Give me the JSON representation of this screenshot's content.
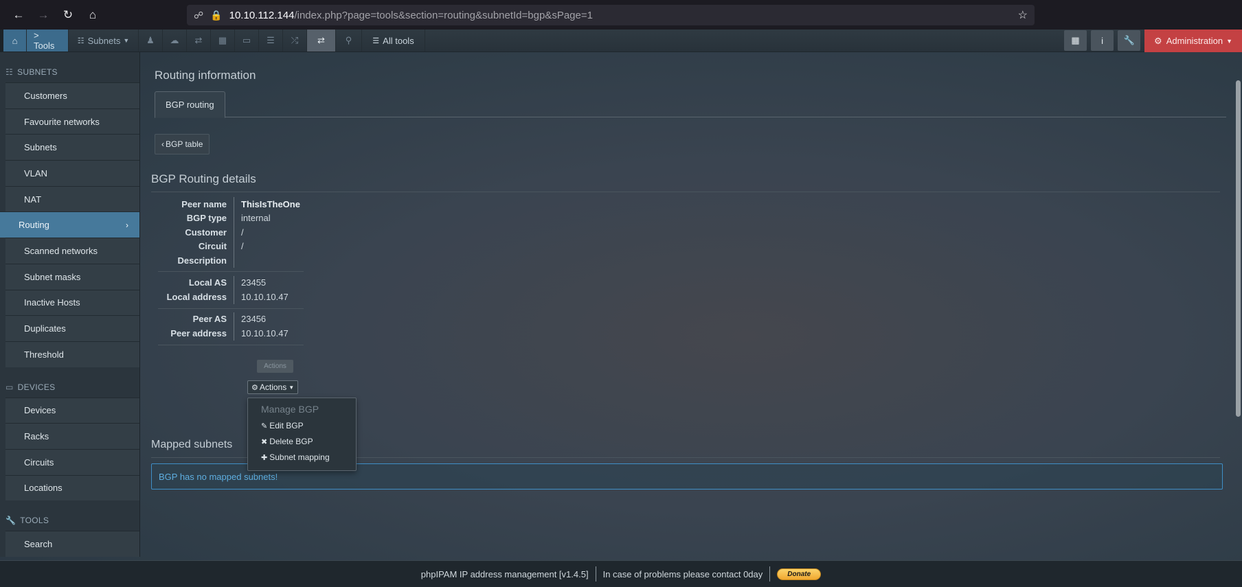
{
  "browser": {
    "url_host": "10.10.112.144",
    "url_path": "/index.php?page=tools&section=routing&subnetId=bgp&sPage=1"
  },
  "topnav": {
    "tools_label": "> Tools",
    "subnets_label": "Subnets",
    "all_tools_label": "All tools",
    "admin_label": "Administration"
  },
  "sidebar": {
    "subnets_heading": "SUBNETS",
    "subnets_items": [
      {
        "label": "Customers"
      },
      {
        "label": "Favourite networks"
      },
      {
        "label": "Subnets"
      },
      {
        "label": "VLAN"
      },
      {
        "label": "NAT"
      },
      {
        "label": "Routing"
      },
      {
        "label": "Scanned networks"
      },
      {
        "label": "Subnet masks"
      },
      {
        "label": "Inactive Hosts"
      },
      {
        "label": "Duplicates"
      },
      {
        "label": "Threshold"
      }
    ],
    "devices_heading": "DEVICES",
    "devices_items": [
      {
        "label": "Devices"
      },
      {
        "label": "Racks"
      },
      {
        "label": "Circuits"
      },
      {
        "label": "Locations"
      }
    ],
    "tools_heading": "TOOLS",
    "tools_items": [
      {
        "label": "Search"
      }
    ]
  },
  "main": {
    "title": "Routing information",
    "tab_bgp": "BGP routing",
    "back_button": "BGP table",
    "details_title": "BGP Routing details",
    "fields": {
      "peer_name_label": "Peer name",
      "peer_name": "ThisIsTheOne",
      "bgp_type_label": "BGP type",
      "bgp_type": "internal",
      "customer_label": "Customer",
      "customer": "/",
      "circuit_label": "Circuit",
      "circuit": "/",
      "description_label": "Description",
      "description": "",
      "local_as_label": "Local AS",
      "local_as": "23455",
      "local_address_label": "Local address",
      "local_address": "10.10.10.47",
      "peer_as_label": "Peer AS",
      "peer_as": "23456",
      "peer_address_label": "Peer address",
      "peer_address": "10.10.10.47"
    },
    "actions_label": "Actions",
    "tooltip": "Actions",
    "dropdown": {
      "header": "Manage BGP",
      "edit": "Edit BGP",
      "delete": "Delete BGP",
      "mapping": "Subnet mapping"
    },
    "mapped_title": "Mapped subnets",
    "no_mapped": "BGP has no mapped subnets!"
  },
  "footer": {
    "app": "phpIPAM IP address management [v1.4.5]",
    "contact": "In case of problems please contact 0day",
    "donate": "Donate"
  },
  "colors": {
    "accent_blue": "#46799b",
    "admin_red": "#c44143",
    "alert_blue": "#3f8fc7"
  }
}
